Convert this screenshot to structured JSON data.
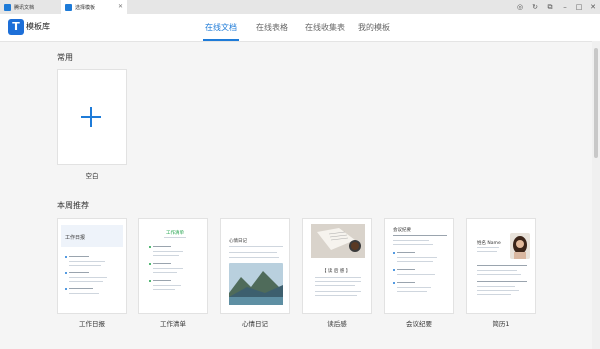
{
  "tabs": [
    {
      "label": "腾讯文档",
      "close": ""
    },
    {
      "label": "选择模板",
      "close": "✕"
    }
  ],
  "window_controls": {
    "icons": [
      "target-icon",
      "refresh-icon",
      "restore-icon",
      "minimize-icon",
      "maximize-icon",
      "close-icon"
    ]
  },
  "header": {
    "logo_glyph": "T",
    "logo_text": "模板库",
    "nav": [
      "在线文档",
      "在线表格",
      "在线收集表",
      "我的模板"
    ],
    "active_nav": "在线文档"
  },
  "sections": {
    "common": {
      "title": "常用",
      "blank_label": "空白"
    },
    "weekly": {
      "title": "本周推荐",
      "items": [
        {
          "label": "工作日报",
          "heading": "工作日报"
        },
        {
          "label": "工作清单",
          "heading": "工作清单"
        },
        {
          "label": "心情日记",
          "heading": "心情日记"
        },
        {
          "label": "读后感",
          "heading": "【 读 后 感 】"
        },
        {
          "label": "会议纪要",
          "heading": "会议纪要"
        },
        {
          "label": "简历1",
          "heading": "姓名 Name"
        }
      ]
    }
  },
  "colors": {
    "accent": "#1e7bd8",
    "green": "#1fa34a"
  }
}
